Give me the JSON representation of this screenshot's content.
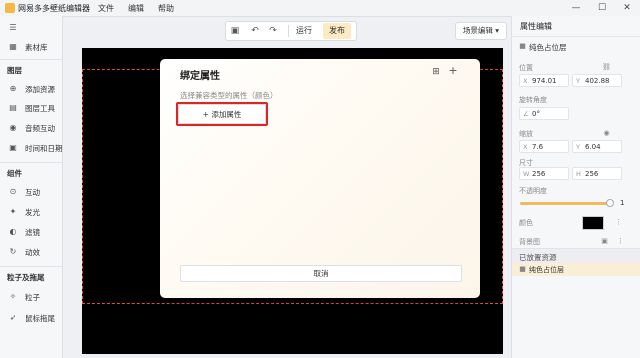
{
  "app": {
    "title": "网易多多壁纸编辑器"
  },
  "menus": [
    "文件",
    "编辑",
    "帮助"
  ],
  "window_controls": {
    "minimize": "—",
    "maximize": "☐",
    "close": "✕"
  },
  "sidebar": {
    "top_item": {
      "label": "素材库",
      "icon": "library-icon"
    },
    "sections": [
      {
        "title": "图层",
        "items": [
          {
            "label": "添加资源",
            "icon": "add-resource-icon"
          },
          {
            "label": "图层工具",
            "icon": "layer-tool-icon"
          },
          {
            "label": "音频互动",
            "icon": "audio-icon"
          },
          {
            "label": "时间和日期",
            "icon": "calendar-icon"
          }
        ]
      },
      {
        "title": "组件",
        "items": [
          {
            "label": "互动",
            "icon": "interaction-icon"
          },
          {
            "label": "发光",
            "icon": "glow-icon"
          },
          {
            "label": "滤镜",
            "icon": "filter-icon"
          },
          {
            "label": "动效",
            "icon": "motion-icon"
          }
        ]
      },
      {
        "title": "粒子及拖尾",
        "items": [
          {
            "label": "粒子",
            "icon": "particle-icon"
          },
          {
            "label": "鼠标拖尾",
            "icon": "mouse-trail-icon"
          }
        ]
      }
    ]
  },
  "toolbar": {
    "run_label": "运行",
    "publish_label": "发布",
    "scene_edit_label": "场景编辑"
  },
  "dialog": {
    "title": "绑定属性",
    "hint": "选择兼容类型的属性（颜色）",
    "add_label": "添加属性",
    "cancel_label": "取消"
  },
  "properties": {
    "title": "属性编辑",
    "layer_name": "纯色占位层",
    "position": {
      "label": "位置",
      "x": "974.01",
      "y": "402.88"
    },
    "rotation": {
      "label": "旋转角度",
      "value": "0°"
    },
    "scale": {
      "label": "缩放",
      "x": "7.6",
      "y": "6.04"
    },
    "size": {
      "label": "尺寸",
      "w": "256",
      "h": "256"
    },
    "opacity": {
      "label": "不透明度",
      "value": "1",
      "fraction": 1.0
    },
    "color": {
      "label": "颜色",
      "value": "#000000"
    },
    "background": {
      "label": "背景图"
    },
    "placed_resources": {
      "label": "已放置资源",
      "items": [
        "纯色占位层"
      ]
    }
  },
  "colors": {
    "accent": "#f4b942",
    "highlight": "#e02424",
    "selection_border": "#e54b4b"
  }
}
